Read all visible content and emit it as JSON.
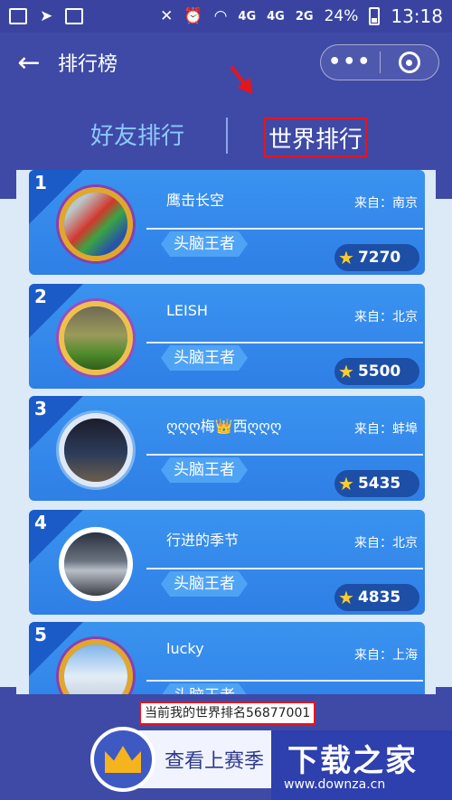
{
  "status_bar": {
    "signal_4g": "4G",
    "signal_4g_small": "4G",
    "signal_2g": "2G",
    "battery": "24%",
    "time": "13:18"
  },
  "header": {
    "back_icon": "←",
    "title": "排行榜",
    "more_icon": "•••"
  },
  "tabs": {
    "friends": "好友排行",
    "world": "世界排行"
  },
  "rankings": [
    {
      "rank": "1",
      "name": "鹰击长空",
      "from": "来自：南京",
      "title": "头脑王者",
      "score": "7270"
    },
    {
      "rank": "2",
      "name": "LEISH",
      "from": "来自：北京",
      "title": "头脑王者",
      "score": "5500"
    },
    {
      "rank": "3",
      "name": "ღღღ梅👑西ღღღ",
      "from": "来自：蚌埠",
      "title": "头脑王者",
      "score": "5435"
    },
    {
      "rank": "4",
      "name": "行进的季节",
      "from": "来自：北京",
      "title": "头脑王者",
      "score": "4835"
    },
    {
      "rank": "5",
      "name": "lucky",
      "from": "来自：上海",
      "title": "头脑王者",
      "score": ""
    }
  ],
  "my_rank": "当前我的世界排名56877001",
  "view_button": "查看上赛季",
  "watermark": {
    "logo": "下载之家",
    "url": "www.downza.cn"
  },
  "colors": {
    "background": "#3f4aa6",
    "card": "#2f7fe6",
    "highlight_border": "#e8141c",
    "star": "#ffcc2a"
  }
}
